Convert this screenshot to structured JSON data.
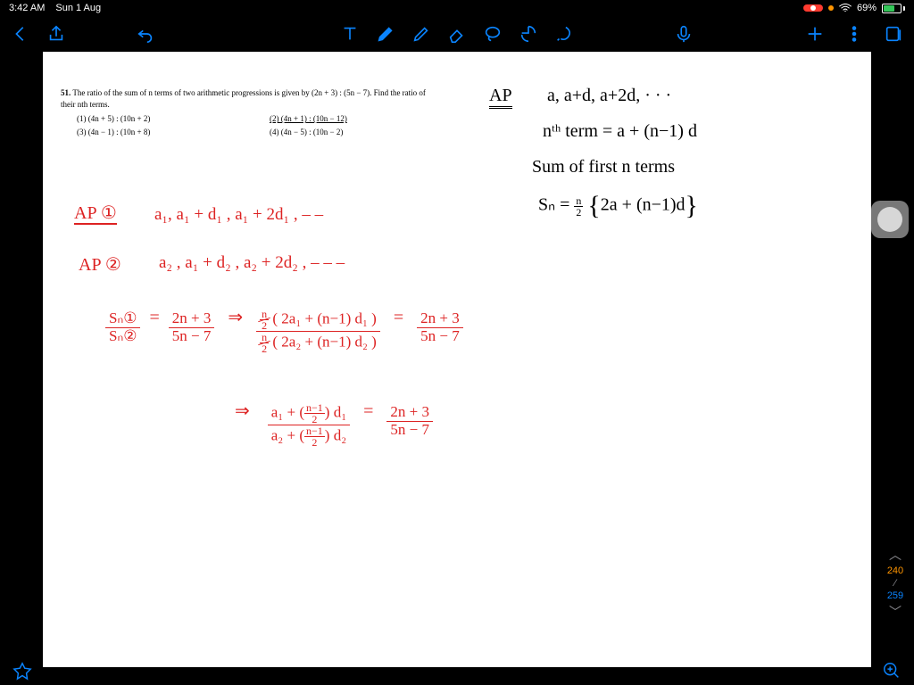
{
  "status": {
    "time": "3:42 AM",
    "date": "Sun 1 Aug",
    "battery_pct": "69%",
    "battery_fill_pct": 69
  },
  "problem": {
    "number": "51.",
    "text": "The ratio of the sum of n terms of two arithmetic progressions is given by (2n + 3) : (5n − 7). Find the ratio of their nth terms.",
    "options": {
      "o1": "(1)  (4n + 5) : (10n + 2)",
      "o2": "(2)  (4n + 1) : (10n − 12)",
      "o3": "(3)  (4n − 1) : (10n + 8)",
      "o4": "(4)  (4n − 5) : (10n − 2)"
    }
  },
  "notes": {
    "ap_label": "AP",
    "ap_seq": "a, a+d, a+2d, · · ·",
    "nth_term": "nᵗʰ term =  a + (n−1) d",
    "sum_label": "Sum of  first  n  terms",
    "sn_formula_left": "Sₙ =",
    "sn_formula_frac_n": "n",
    "sn_formula_frac_2": "2",
    "sn_formula_body": "2a + (n−1)d",
    "ap1_label": "AP ①",
    "ap1_seq": "a₁,  a₁ + d₁ ,  a₁ + 2d₁ ,  – –",
    "ap2_label": "AP ②",
    "ap2_seq": "a₂ ,  a₁ + d₂ ,  a₂ + 2d₂ ,  – – –",
    "ratio_lhs_num": "Sₙ①",
    "ratio_lhs_den": "Sₙ②",
    "ratio_mid_num": "2n + 3",
    "ratio_mid_den": "5n − 7",
    "implies": "⇒",
    "expand_num": "( 2a₁ + (n−1) d₁ )",
    "expand_den": "( 2a₂ + (n−1) d₂ )",
    "expand_coef_n": "n",
    "expand_coef_2": "2",
    "rhs_num": "2n + 3",
    "rhs_den": "5n − 7",
    "final_num_a": "a₁ +",
    "final_num_b": "d₁",
    "final_den_a": "a₂ +",
    "final_den_b": "d₂",
    "nminus1": "n−1",
    "two": "2",
    "eq": "="
  },
  "pager": {
    "current": "240",
    "total": "259"
  }
}
